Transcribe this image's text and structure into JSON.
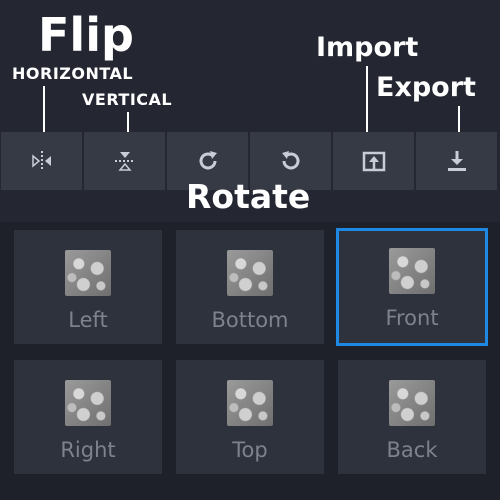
{
  "labels": {
    "flip": "Flip",
    "horizontal": "HORIZONTAL",
    "vertical": "VERTICAL",
    "import": "Import",
    "export": "Export",
    "rotate": "Rotate"
  },
  "toolbar": {
    "buttons": [
      {
        "icon": "flip-horizontal-icon"
      },
      {
        "icon": "flip-vertical-icon"
      },
      {
        "icon": "rotate-clockwise-icon"
      },
      {
        "icon": "rotate-counterclockwise-icon"
      },
      {
        "icon": "import-icon"
      },
      {
        "icon": "export-icon"
      }
    ]
  },
  "faces": [
    {
      "label": "Left",
      "selected": false
    },
    {
      "label": "Bottom",
      "selected": false
    },
    {
      "label": "Front",
      "selected": true
    },
    {
      "label": "Right",
      "selected": false
    },
    {
      "label": "Top",
      "selected": false
    },
    {
      "label": "Back",
      "selected": false
    }
  ],
  "colors": {
    "background": "#242731",
    "toolbar_button": "#363a45",
    "panel": "#1e212a",
    "face_tile": "#2e323c",
    "selected_border": "#1e88e5",
    "face_label": "#7d828d",
    "annotation_text": "#ffffff"
  }
}
